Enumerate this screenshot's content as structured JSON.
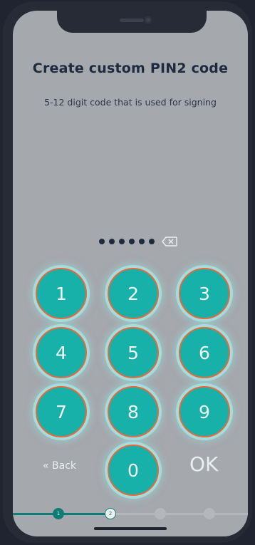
{
  "header": {
    "title": "Create custom PIN2 code",
    "subtitle": "5-12 digit code that is used for signing"
  },
  "pin_entry": {
    "entered_count": 6,
    "backspace_icon": "backspace-icon"
  },
  "keypad": {
    "keys": [
      "1",
      "2",
      "3",
      "4",
      "5",
      "6",
      "7",
      "8",
      "9",
      "0"
    ]
  },
  "actions": {
    "back_label": "« Back",
    "ok_label": "OK"
  },
  "progress": {
    "steps": [
      {
        "label": "1",
        "state": "done"
      },
      {
        "label": "2",
        "state": "current"
      },
      {
        "label": "3",
        "state": "todo"
      },
      {
        "label": "4",
        "state": "todo"
      }
    ]
  },
  "colors": {
    "screen_bg": "#a5a8ad",
    "key_fill": "#17b1a9",
    "key_ring": "#e76a3a",
    "title_text": "#1e2b3e",
    "progress_active": "#0f7d76"
  }
}
